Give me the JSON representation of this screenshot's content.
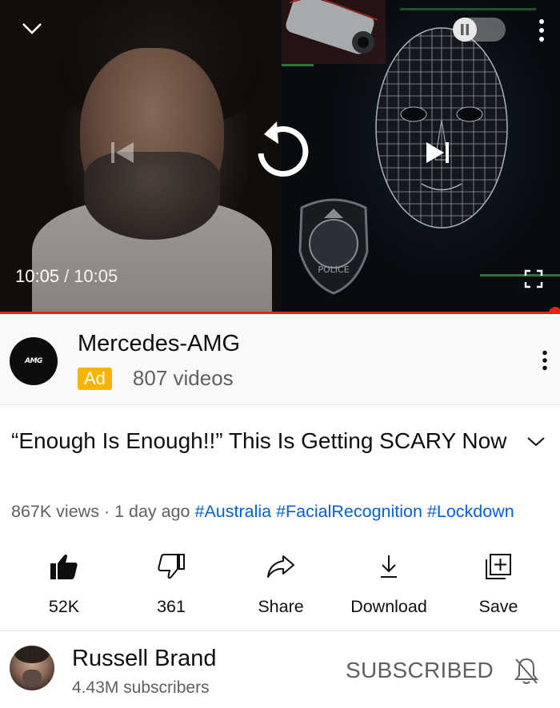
{
  "player": {
    "current_time": "10:05",
    "separator": "/",
    "duration": "10:05",
    "progress": 1.0,
    "state": "ended",
    "badge_text": "POLICE",
    "controls": [
      "collapse-icon",
      "pause-icon",
      "more-vert-icon",
      "skip-previous-icon",
      "replay-icon",
      "skip-next-icon",
      "fullscreen-icon"
    ]
  },
  "ad": {
    "advertiser": "Mercedes-AMG",
    "logo_text": "AMG",
    "badge": "Ad",
    "videos_count": "807 videos"
  },
  "video": {
    "title": "“Enough Is Enough!!” This Is Getting SCARY Now",
    "views": "867K views",
    "dot": " · ",
    "age": "1 day ago",
    "hashtags": [
      "#Australia",
      "#FacialRecognition",
      "#Lockdown"
    ]
  },
  "actions": {
    "like": "52K",
    "dislike": "361",
    "share": "Share",
    "download": "Download",
    "save": "Save"
  },
  "channel": {
    "name": "Russell Brand",
    "subscribers": "4.43M subscribers",
    "subscribe_state": "SUBSCRIBED"
  },
  "colors": {
    "progress": "#e62117",
    "ad_badge": "#f7b400",
    "hashtag": "#065fd4",
    "secondary_text": "#606060"
  }
}
